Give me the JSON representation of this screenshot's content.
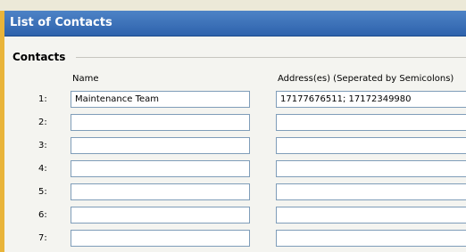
{
  "window": {
    "title": "List of Contacts"
  },
  "group": {
    "title": "Contacts"
  },
  "columns": {
    "name": "Name",
    "addresses": "Address(es) (Seperated by Semicolons)"
  },
  "rows": [
    {
      "num": "1:",
      "name": "Maintenance Team",
      "address": "17177676511; 17172349980"
    },
    {
      "num": "2:",
      "name": "",
      "address": ""
    },
    {
      "num": "3:",
      "name": "",
      "address": ""
    },
    {
      "num": "4:",
      "name": "",
      "address": ""
    },
    {
      "num": "5:",
      "name": "",
      "address": ""
    },
    {
      "num": "6:",
      "name": "",
      "address": ""
    },
    {
      "num": "7:",
      "name": "",
      "address": ""
    }
  ]
}
